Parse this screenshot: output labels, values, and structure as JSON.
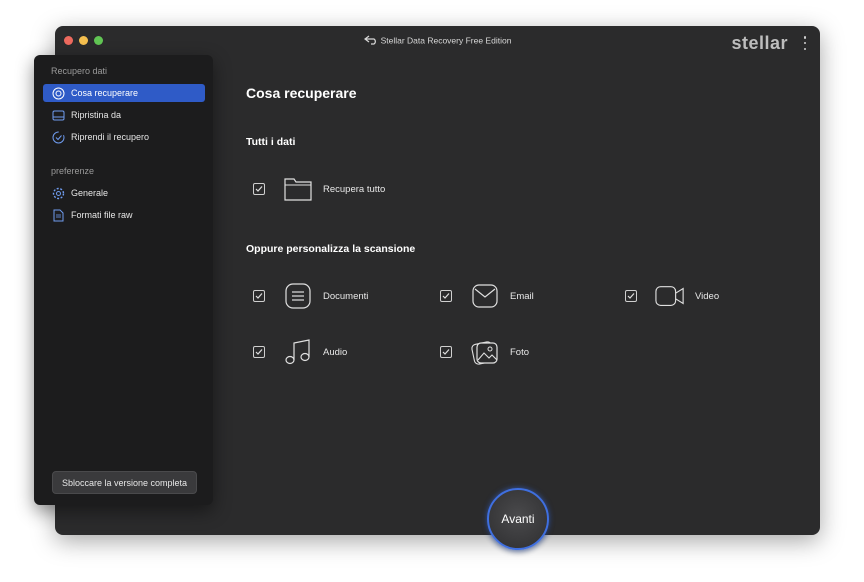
{
  "window": {
    "title": "Stellar Data Recovery Free Edition",
    "logo": "stellar"
  },
  "sidebar": {
    "section_recovery": "Recupero dati",
    "items": [
      {
        "label": "Cosa recuperare",
        "icon": "recover-icon",
        "active": true
      },
      {
        "label": "Ripristina da",
        "icon": "drive-icon",
        "active": false
      },
      {
        "label": "Riprendi il recupero",
        "icon": "resume-icon",
        "active": false
      }
    ],
    "section_prefs": "preferenze",
    "pref_items": [
      {
        "label": "Generale",
        "icon": "gear-icon"
      },
      {
        "label": "Formati file raw",
        "icon": "file-format-icon"
      }
    ],
    "unlock_label": "Sbloccare la versione completa"
  },
  "main": {
    "title": "Cosa recuperare",
    "all_section": "Tutti i dati",
    "all_option": {
      "label": "Recupera tutto",
      "checked": true,
      "icon": "folder-icon"
    },
    "custom_section": "Oppure personalizza la scansione",
    "options": [
      {
        "label": "Documenti",
        "checked": true,
        "icon": "document-icon"
      },
      {
        "label": "Email",
        "checked": true,
        "icon": "email-icon"
      },
      {
        "label": "Video",
        "checked": true,
        "icon": "video-icon"
      },
      {
        "label": "Audio",
        "checked": true,
        "icon": "audio-icon"
      },
      {
        "label": "Foto",
        "checked": true,
        "icon": "photo-icon"
      }
    ]
  },
  "next_label": "Avanti",
  "colors": {
    "accent": "#2f5bc7",
    "window_bg": "#2b2b2c",
    "sidebar_bg": "#1c1c1d"
  }
}
